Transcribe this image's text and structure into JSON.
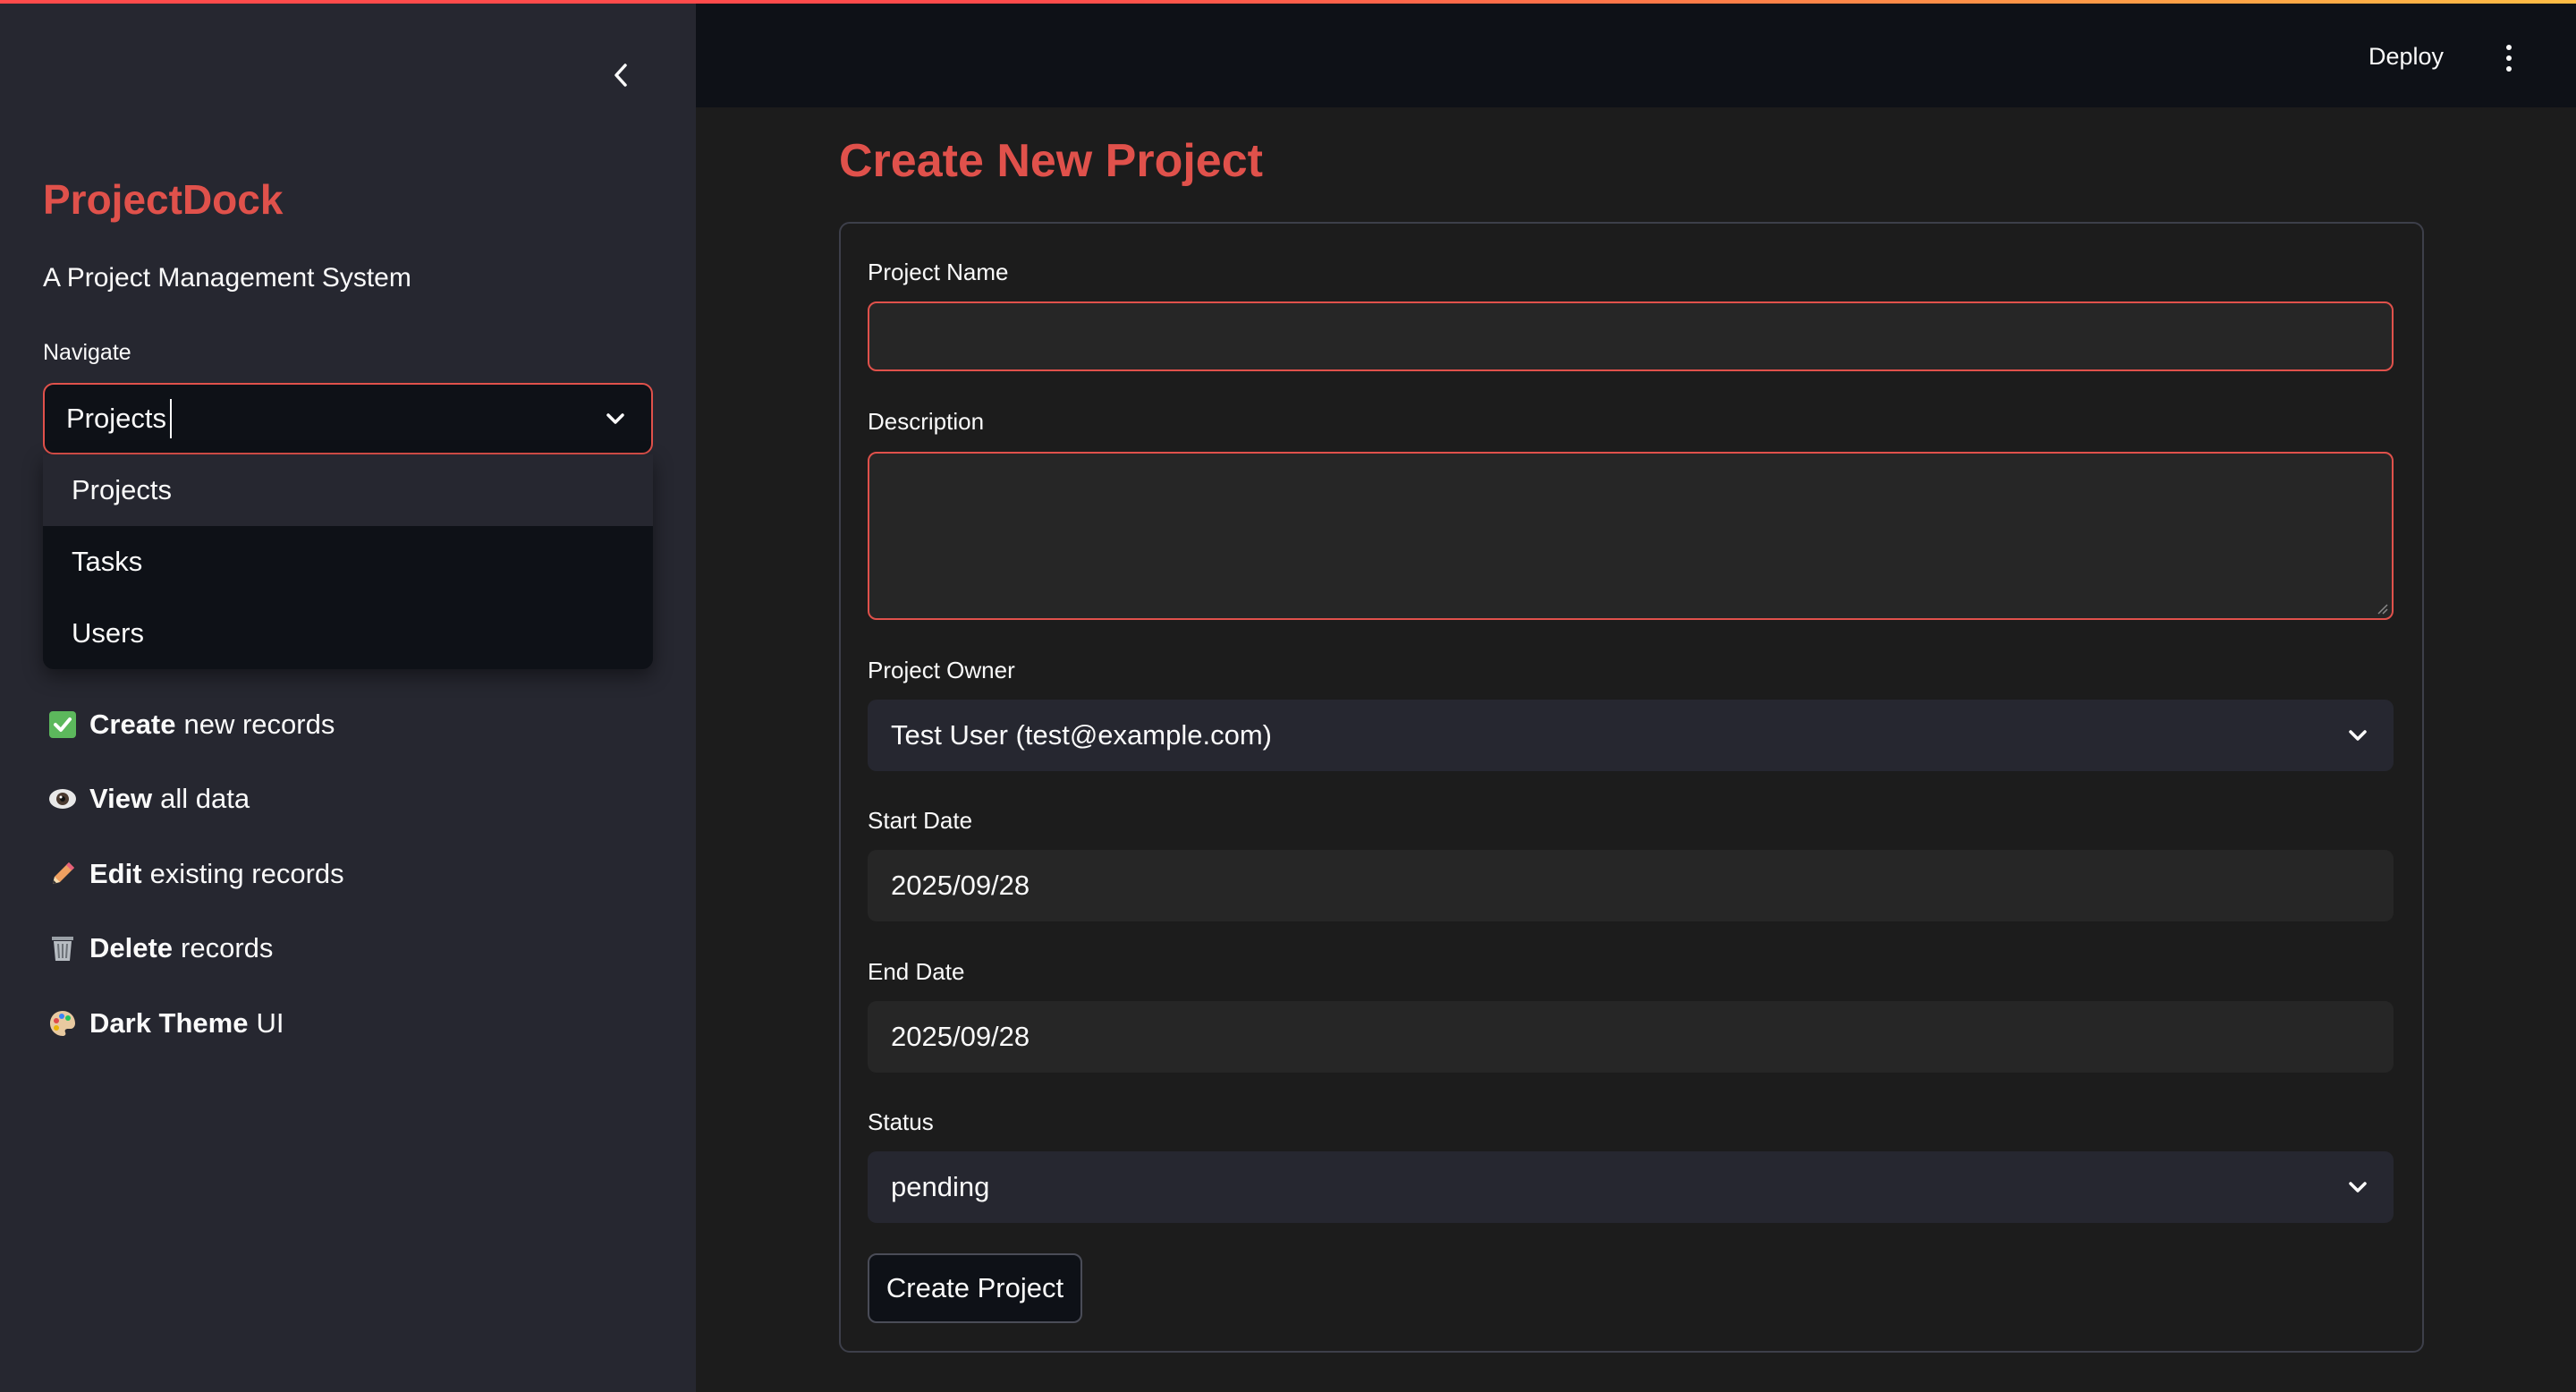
{
  "app": {
    "brand": "ProjectDock",
    "subtitle": "A Project Management System",
    "accent_color": "#e0514b"
  },
  "header": {
    "deploy_label": "Deploy",
    "menu_icon": "kebab-menu-icon"
  },
  "sidebar": {
    "collapse_icon": "chevron-left-icon",
    "nav_label": "Navigate",
    "nav_selected": "Projects",
    "nav_options": [
      {
        "label": "Projects",
        "active": true
      },
      {
        "label": "Tasks",
        "active": false
      },
      {
        "label": "Users",
        "active": false
      }
    ],
    "features": [
      {
        "icon": "check-mark-icon",
        "bold": "Create",
        "rest": "new records"
      },
      {
        "icon": "eye-icon",
        "bold": "View",
        "rest": "all data"
      },
      {
        "icon": "pencil-icon",
        "bold": "Edit",
        "rest": "existing records"
      },
      {
        "icon": "wastebasket-icon",
        "bold": "Delete",
        "rest": "records"
      },
      {
        "icon": "palette-icon",
        "bold": "Dark Theme",
        "rest": "UI"
      }
    ]
  },
  "form": {
    "title": "Create New Project",
    "project_name_label": "Project Name",
    "project_name_value": "",
    "description_label": "Description",
    "description_value": "",
    "owner_label": "Project Owner",
    "owner_value": "Test User (test@example.com)",
    "start_date_label": "Start Date",
    "start_date_value": "2025/09/28",
    "end_date_label": "End Date",
    "end_date_value": "2025/09/28",
    "status_label": "Status",
    "status_value": "pending",
    "submit_label": "Create Project"
  }
}
